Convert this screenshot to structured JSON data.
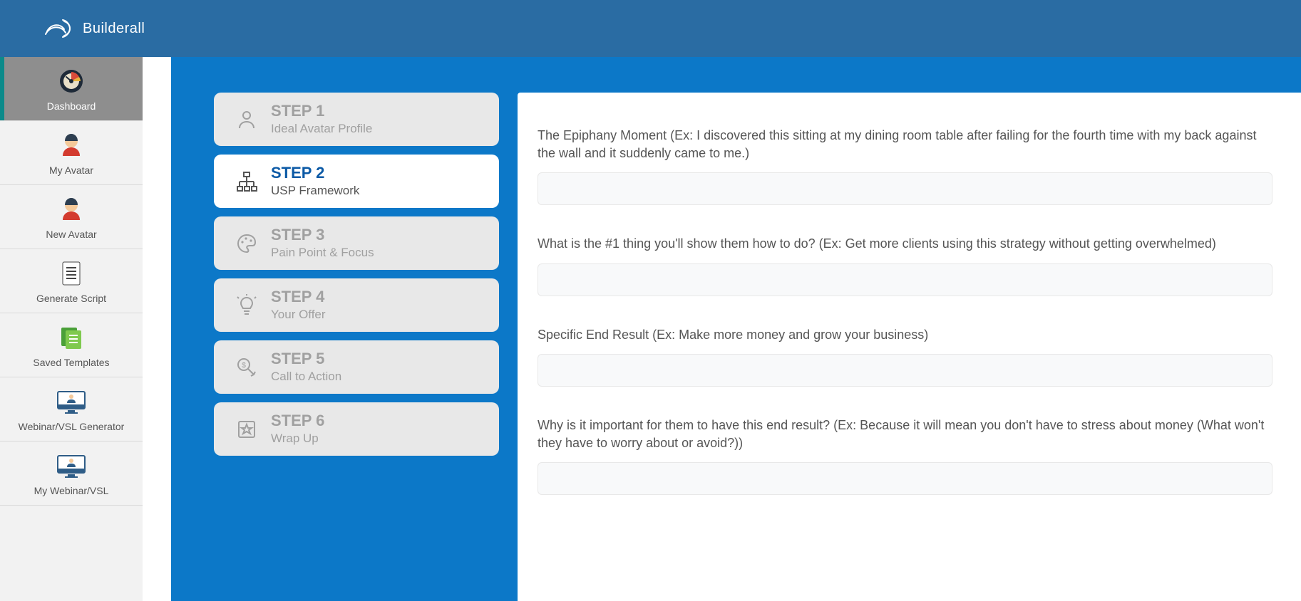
{
  "brand": {
    "name": "Builderall"
  },
  "colors": {
    "topbar": "#2a6ca3",
    "panel": "#0c78c8",
    "sidebar_selected": "#8e8e8e",
    "sidebar_accent": "#0c8a8a"
  },
  "sidebar": {
    "items": [
      {
        "label": "Dashboard",
        "icon": "gauge-icon",
        "selected": true
      },
      {
        "label": "My Avatar",
        "icon": "avatar-icon",
        "selected": false
      },
      {
        "label": "New Avatar",
        "icon": "avatar-icon",
        "selected": false
      },
      {
        "label": "Generate Script",
        "icon": "document-icon",
        "selected": false
      },
      {
        "label": "Saved Templates",
        "icon": "stack-icon",
        "selected": false
      },
      {
        "label": "Webinar/VSL Generator",
        "icon": "monitor-icon",
        "selected": false
      },
      {
        "label": "My Webinar/VSL",
        "icon": "monitor-icon",
        "selected": false
      }
    ]
  },
  "stepper": {
    "steps": [
      {
        "title": "STEP 1",
        "subtitle": "Ideal Avatar Profile",
        "icon": "person-icon",
        "active": false
      },
      {
        "title": "STEP 2",
        "subtitle": "USP Framework",
        "icon": "sitemap-icon",
        "active": true
      },
      {
        "title": "STEP 3",
        "subtitle": "Pain Point & Focus",
        "icon": "palette-icon",
        "active": false
      },
      {
        "title": "STEP 4",
        "subtitle": "Your Offer",
        "icon": "lightbulb-icon",
        "active": false
      },
      {
        "title": "STEP 5",
        "subtitle": "Call to Action",
        "icon": "money-icon",
        "active": false
      },
      {
        "title": "STEP 6",
        "subtitle": "Wrap Up",
        "icon": "star-box-icon",
        "active": false
      }
    ]
  },
  "form": {
    "fields": [
      {
        "label": "The Epiphany Moment (Ex: I discovered this sitting at my dining room table after failing for the fourth time with my back against the wall and it suddenly came to me.)",
        "value": ""
      },
      {
        "label": "What is the #1 thing you'll show them how to do? (Ex: Get more clients using this strategy without getting overwhelmed)",
        "value": ""
      },
      {
        "label": "Specific End Result (Ex: Make more money and grow your business)",
        "value": ""
      },
      {
        "label": "Why is it important for them to have this end result? (Ex: Because it will mean you don't have to stress about money (What won't they have to worry about or avoid?))",
        "value": ""
      }
    ]
  }
}
